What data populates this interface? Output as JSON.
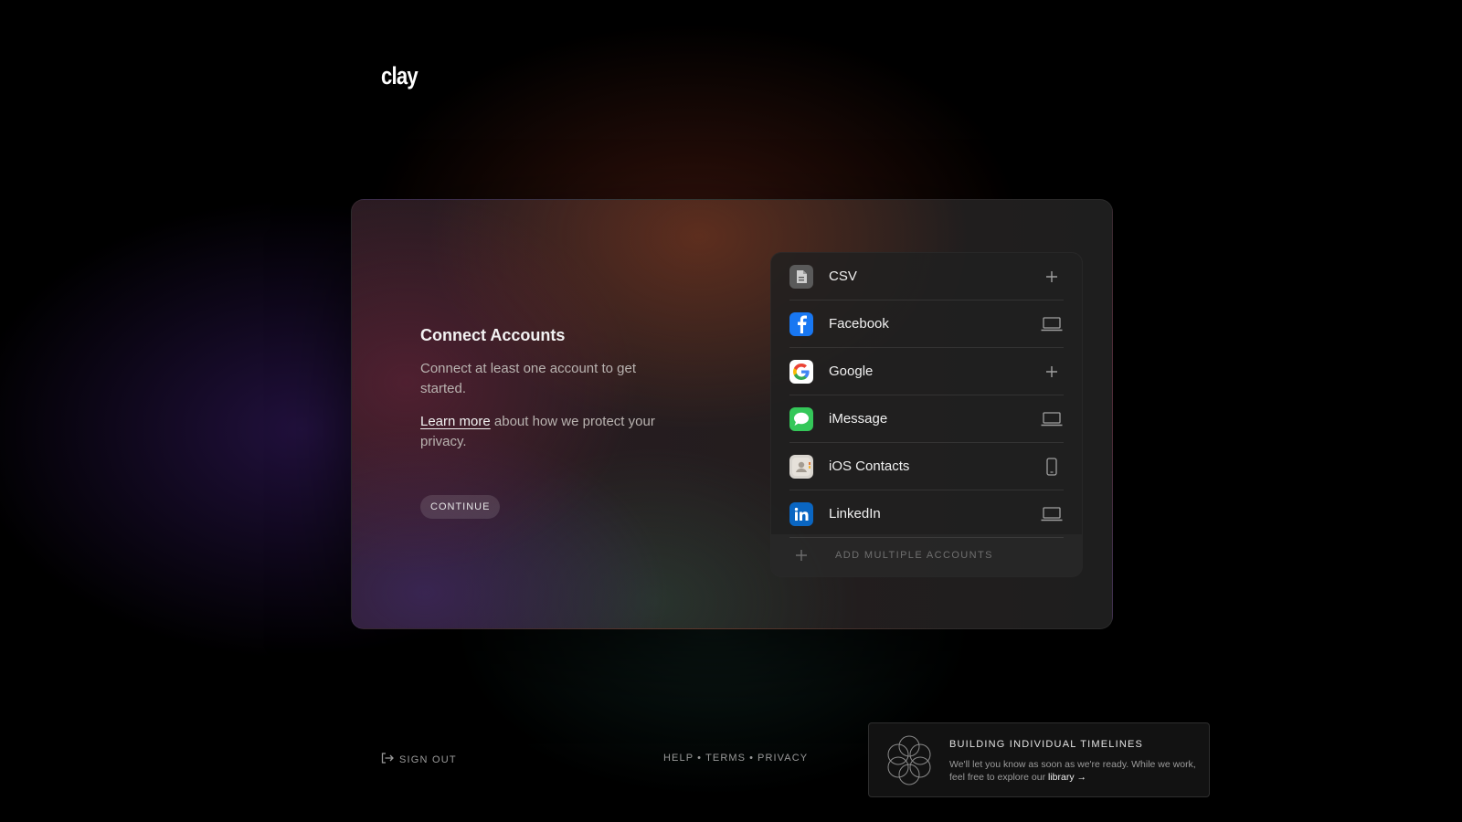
{
  "brand": {
    "logo_text": "clay"
  },
  "onboarding": {
    "heading": "Connect Accounts",
    "description": "Connect at least one account to get started.",
    "learn_more_link": "Learn more",
    "privacy_suffix": " about how we protect your privacy.",
    "continue_label": "CONTINUE"
  },
  "accounts": [
    {
      "label": "CSV",
      "icon": "csv-file-icon",
      "action": "plus-icon"
    },
    {
      "label": "Facebook",
      "icon": "facebook-icon",
      "action": "laptop-icon"
    },
    {
      "label": "Google",
      "icon": "google-icon",
      "action": "plus-icon"
    },
    {
      "label": "iMessage",
      "icon": "imessage-icon",
      "action": "laptop-icon"
    },
    {
      "label": "iOS Contacts",
      "icon": "ios-contacts-icon",
      "action": "phone-icon"
    },
    {
      "label": "LinkedIn",
      "icon": "linkedin-icon",
      "action": "laptop-icon"
    }
  ],
  "add_multiple_label": "ADD MULTIPLE ACCOUNTS",
  "footer": {
    "sign_out_label": "SIGN OUT",
    "help_label": "HELP",
    "terms_label": "TERMS",
    "privacy_label": "PRIVACY",
    "separator": "•"
  },
  "notice": {
    "title": "BUILDING INDIVIDUAL TIMELINES",
    "body": "We'll let you know as soon as we're ready. While we work, feel free to explore our ",
    "link_label": "library →"
  },
  "colors": {
    "facebook": "#1877f2",
    "imessage": "#34c759",
    "linkedin": "#0a66c2",
    "google_red": "#ea4335",
    "google_blue": "#4285f4",
    "google_yellow": "#fbbc05",
    "google_green": "#34a853"
  }
}
